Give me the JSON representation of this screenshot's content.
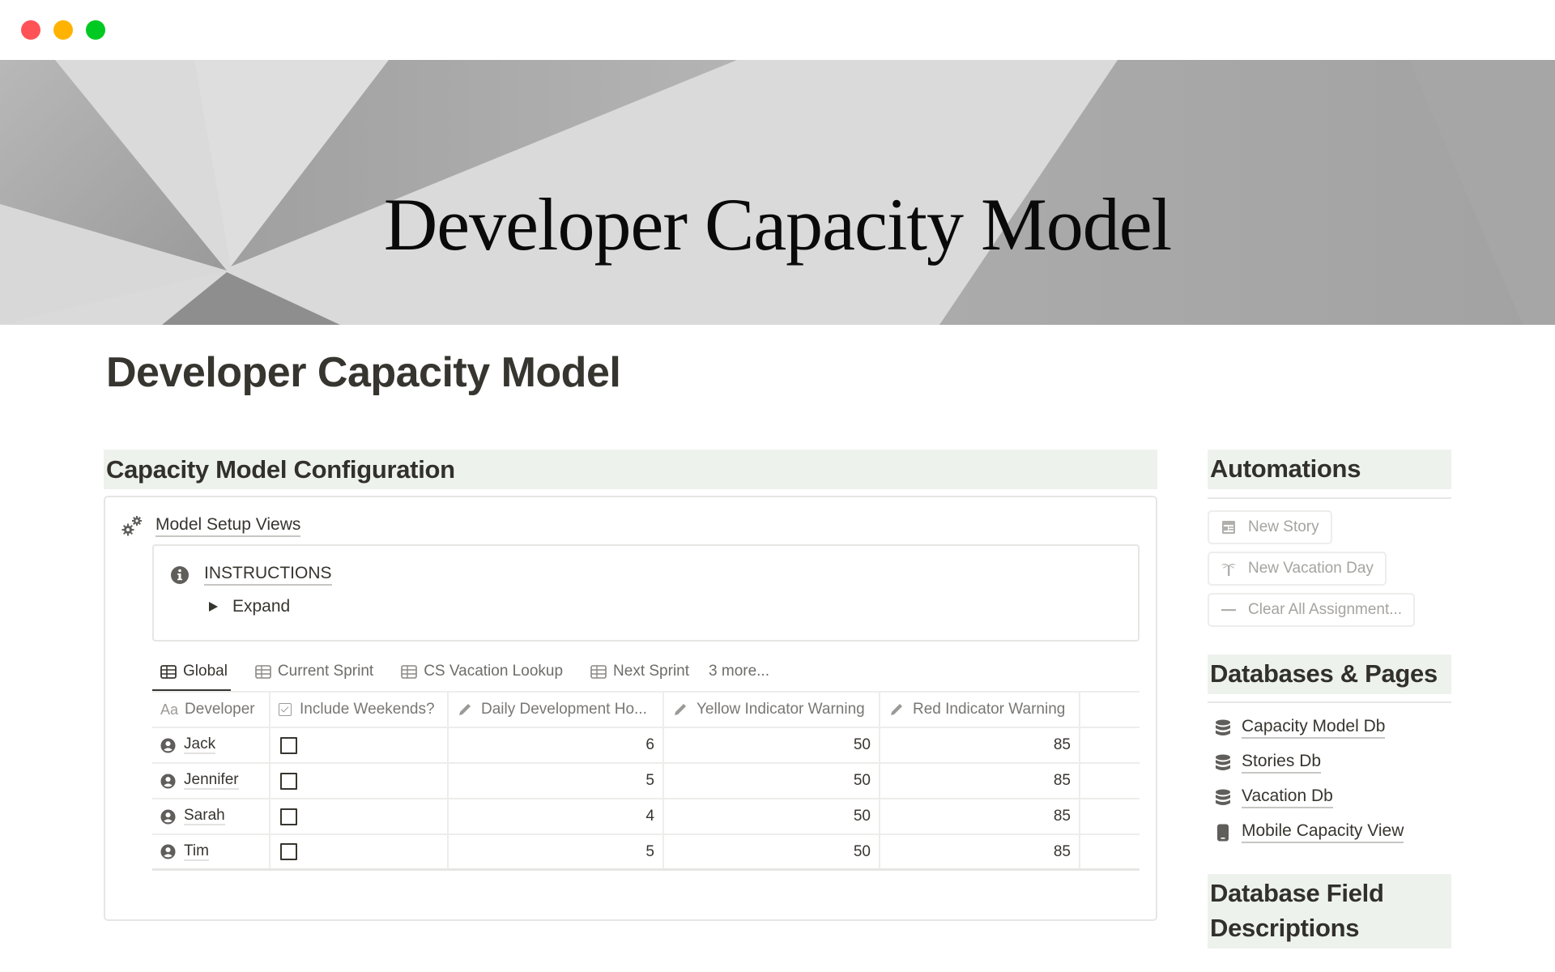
{
  "window": {
    "controls": [
      "close",
      "minimize",
      "zoom"
    ]
  },
  "banner": {
    "title": "Developer Capacity Model"
  },
  "page": {
    "title": "Developer Capacity Model"
  },
  "config": {
    "heading": "Capacity Model Configuration",
    "setup_link": "Model Setup Views",
    "callout": {
      "title": "INSTRUCTIONS",
      "toggle_label": "Expand"
    },
    "tabs": [
      {
        "label": "Global",
        "active": true
      },
      {
        "label": "Current Sprint",
        "active": false
      },
      {
        "label": "CS Vacation Lookup",
        "active": false
      },
      {
        "label": "Next Sprint",
        "active": false
      }
    ],
    "more_tabs": "3 more...",
    "table": {
      "columns": [
        {
          "label": "Developer",
          "icon": "Aa"
        },
        {
          "label": "Include Weekends?",
          "icon": "checkbox"
        },
        {
          "label": "Daily Development Ho...",
          "icon": "pencil"
        },
        {
          "label": "Yellow Indicator Warning",
          "icon": "pencil"
        },
        {
          "label": "Red Indicator Warning",
          "icon": "pencil"
        }
      ],
      "rows": [
        {
          "developer": "Jack",
          "include_weekends": false,
          "daily_hours": "6",
          "yellow": "50",
          "red": "85"
        },
        {
          "developer": "Jennifer",
          "include_weekends": false,
          "daily_hours": "5",
          "yellow": "50",
          "red": "85"
        },
        {
          "developer": "Sarah",
          "include_weekends": false,
          "daily_hours": "4",
          "yellow": "50",
          "red": "85"
        },
        {
          "developer": "Tim",
          "include_weekends": false,
          "daily_hours": "5",
          "yellow": "50",
          "red": "85"
        }
      ]
    }
  },
  "automations": {
    "heading": "Automations",
    "buttons": [
      {
        "label": "New Story",
        "icon": "calendar-icon"
      },
      {
        "label": "New Vacation Day",
        "icon": "palm-tree-icon"
      },
      {
        "label": "Clear All Assignment...",
        "icon": "minus-icon"
      }
    ]
  },
  "databases": {
    "heading": "Databases & Pages",
    "items": [
      {
        "label": "Capacity Model Db",
        "icon": "database-icon"
      },
      {
        "label": "Stories Db",
        "icon": "database-icon"
      },
      {
        "label": "Vacation Db",
        "icon": "database-icon"
      },
      {
        "label": "Mobile Capacity View",
        "icon": "mobile-icon"
      }
    ]
  },
  "field_descriptions": {
    "heading": "Database Field Descriptions"
  },
  "colors": {
    "heading_bg": "#edf3ec",
    "text": "#37352f",
    "muted": "#787774",
    "close": "#ff5257",
    "minimize": "#ffb300",
    "zoom": "#00c922"
  }
}
